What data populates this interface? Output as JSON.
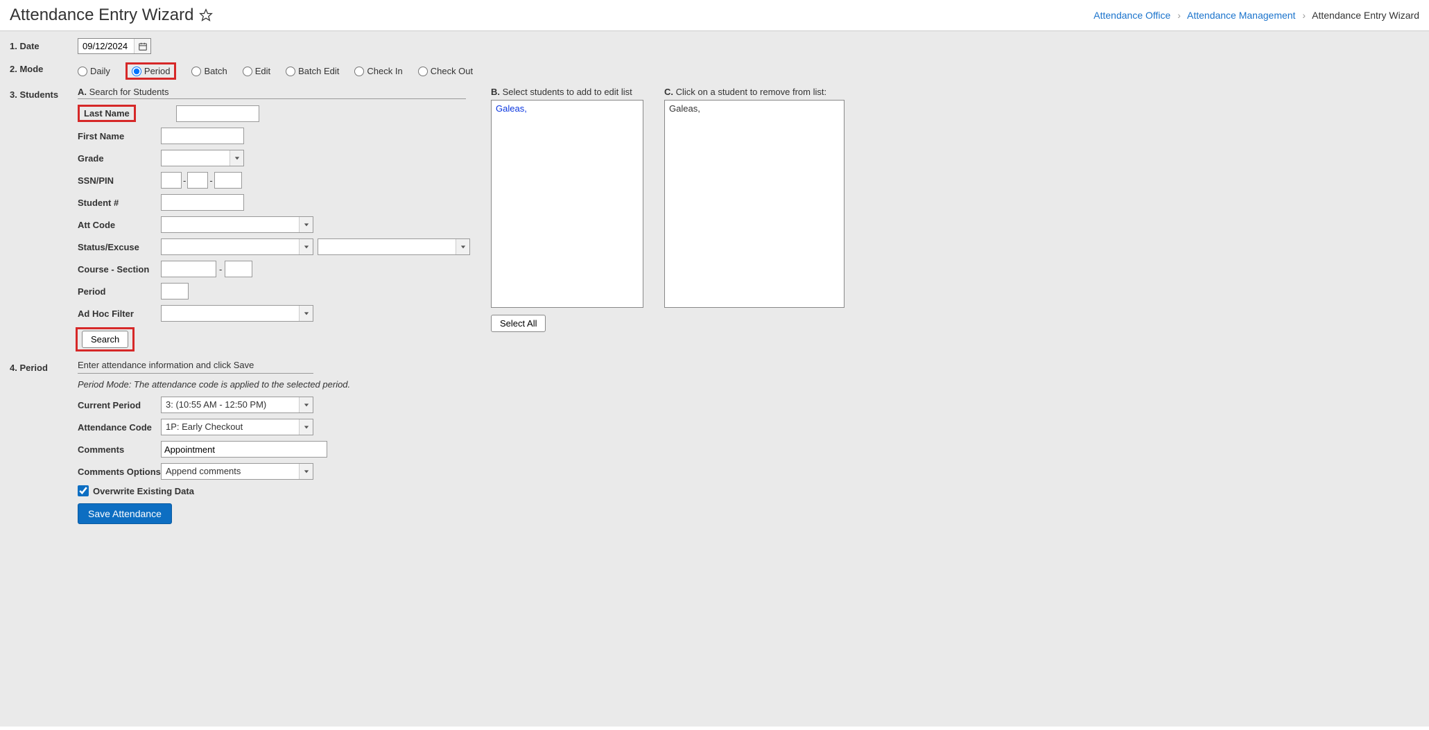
{
  "header": {
    "title": "Attendance Entry Wizard",
    "breadcrumb": {
      "a": "Attendance Office",
      "b": "Attendance Management",
      "c": "Attendance Entry Wizard"
    }
  },
  "steps": {
    "date_label": "1. Date",
    "mode_label": "2. Mode",
    "students_label": "3. Students",
    "period_label": "4. Period"
  },
  "date": {
    "value": "09/12/2024"
  },
  "mode_options": {
    "daily": "Daily",
    "period": "Period",
    "batch": "Batch",
    "edit": "Edit",
    "batch_edit": "Batch Edit",
    "check_in": "Check In",
    "check_out": "Check Out"
  },
  "students": {
    "search_header_letter": "A.",
    "search_header_text": "Search for Students",
    "select_header_letter": "B.",
    "select_header_text": "Select students to add to edit list",
    "remove_header_letter": "C.",
    "remove_header_text": "Click on a student to remove from list:",
    "labels": {
      "last_name": "Last Name",
      "first_name": "First Name",
      "grade": "Grade",
      "ssn_pin": "SSN/PIN",
      "student_no": "Student #",
      "att_code": "Att Code",
      "status_excuse": "Status/Excuse",
      "course_section": "Course - Section",
      "period": "Period",
      "adhoc": "Ad Hoc Filter"
    },
    "values": {
      "last_name": "",
      "first_name": "",
      "grade": "",
      "ssn1": "",
      "ssn2": "",
      "ssn3": "",
      "student_no": "",
      "att_code": "",
      "status": "",
      "excuse": "",
      "course": "",
      "section": "",
      "period": "",
      "adhoc": ""
    },
    "search_button": "Search",
    "select_all_button": "Select All",
    "result_list": [
      "Galeas,"
    ],
    "edit_list": [
      "Galeas,"
    ]
  },
  "period": {
    "header": "Enter attendance information and click Save",
    "note": "Period Mode: The attendance code is applied to the selected period.",
    "labels": {
      "current_period": "Current Period",
      "attendance_code": "Attendance Code",
      "comments": "Comments",
      "comments_options": "Comments Options",
      "overwrite": "Overwrite Existing Data"
    },
    "values": {
      "current_period": "3: (10:55 AM - 12:50 PM)",
      "attendance_code": "1P: Early Checkout",
      "comments": "Appointment",
      "comments_options": "Append comments",
      "overwrite_checked": true
    },
    "save_button": "Save Attendance"
  }
}
